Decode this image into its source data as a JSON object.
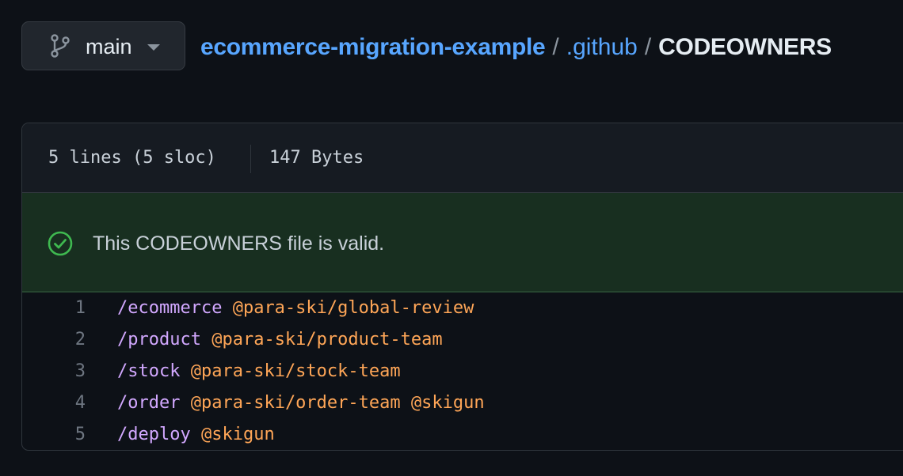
{
  "branch": {
    "icon": "git-branch-icon",
    "name": "main",
    "caret_icon": "caret-down-icon"
  },
  "breadcrumb": {
    "repo": "ecommerce-migration-example",
    "separator": "/",
    "folder": ".github",
    "file": "CODEOWNERS"
  },
  "file_info": {
    "lines": "5 lines (5 sloc)",
    "size": "147 Bytes"
  },
  "validation": {
    "icon": "check-circle-icon",
    "message": "This CODEOWNERS file is valid.",
    "color": "#3fb950"
  },
  "code_lines": [
    {
      "number": "1",
      "path": "/ecommerce",
      "owners": "@para-ski/global-review"
    },
    {
      "number": "2",
      "path": "/product",
      "owners": "@para-ski/product-team"
    },
    {
      "number": "3",
      "path": "/stock",
      "owners": "@para-ski/stock-team"
    },
    {
      "number": "4",
      "path": "/order",
      "owners": "@para-ski/order-team @skigun"
    },
    {
      "number": "5",
      "path": "/deploy",
      "owners": "@skigun"
    }
  ],
  "colors": {
    "background": "#0d1117",
    "link": "#58a6ff",
    "path_token": "#d2a8ff",
    "owner_token": "#ffa657",
    "banner_bg": "#182f20"
  }
}
